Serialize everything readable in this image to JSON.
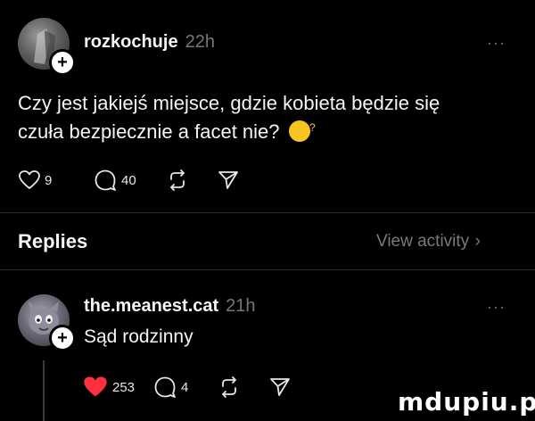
{
  "post": {
    "username": "rozkochuje",
    "time": "22h",
    "more_label": "···",
    "text": "Czy jest jakiejś miejsce, gdzie kobieta będzie się czuła bezpiecznie a facet nie?",
    "emoji": "thinking-face",
    "likes": "9",
    "comments": "40"
  },
  "replies_header": {
    "title": "Replies",
    "view_activity": "View activity"
  },
  "reply": {
    "username": "the.meanest.cat",
    "time": "21h",
    "more_label": "···",
    "text": "Sąd rodzinny",
    "likes": "253",
    "comments": "4"
  },
  "watermark": "mdupiu.pl",
  "colors": {
    "background": "#000000",
    "text": "#f5f5f5",
    "muted": "#777777",
    "like_red": "#ff3040"
  },
  "icons": [
    "plus-icon",
    "heart-outline-icon",
    "heart-filled-icon",
    "comment-icon",
    "repost-icon",
    "share-icon",
    "chevron-right-icon"
  ]
}
